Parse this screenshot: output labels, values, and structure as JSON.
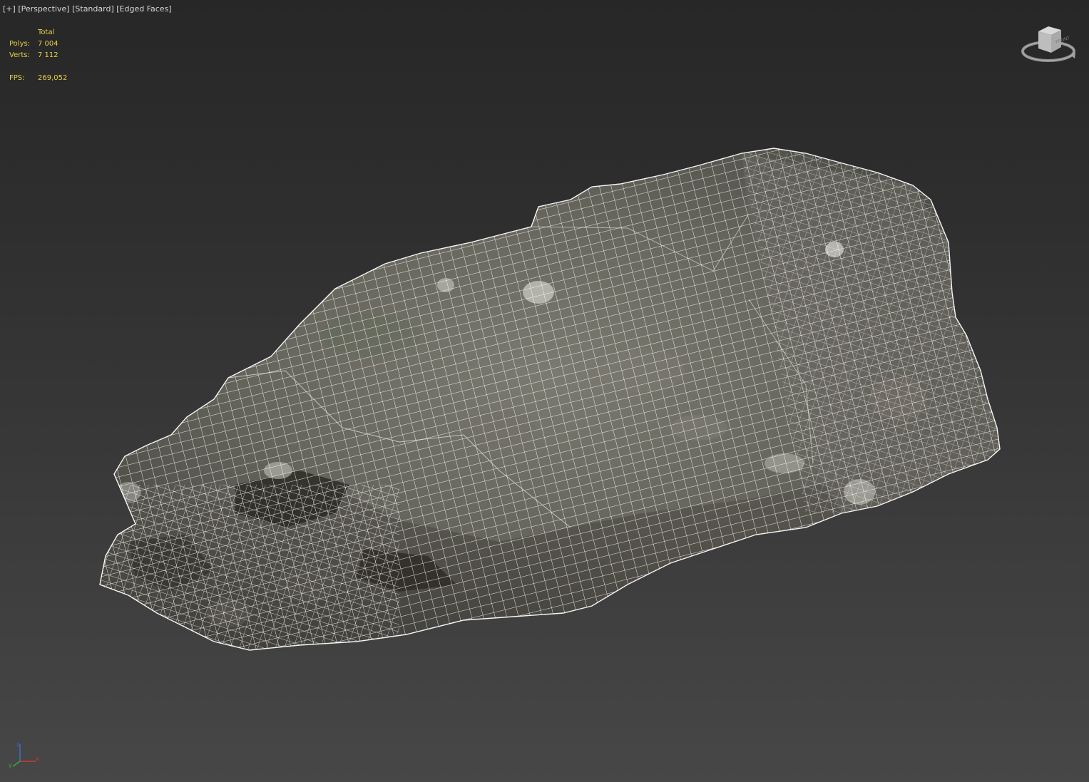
{
  "viewport": {
    "labels": [
      "[+]",
      "[Perspective]",
      "[Standard]",
      "[Edged Faces]"
    ],
    "stats": {
      "header": "Total",
      "polys_label": "Polys:",
      "polys_value": "7 004",
      "verts_label": "Verts:",
      "verts_value": "7 112",
      "fps_label": "FPS:",
      "fps_value": "269,052"
    },
    "viewcube": {
      "face_label": "FRONT",
      "icon": "viewcube-icon"
    },
    "axis_tripod": {
      "icon": "axis-tripod-icon",
      "axes": [
        "x",
        "y",
        "z"
      ]
    },
    "colors": {
      "stats_text": "#e6cf4a",
      "label_text": "#d8d8d8",
      "wireframe": "#ffffff",
      "background_top": "#272727",
      "background_bottom": "#474747"
    }
  }
}
